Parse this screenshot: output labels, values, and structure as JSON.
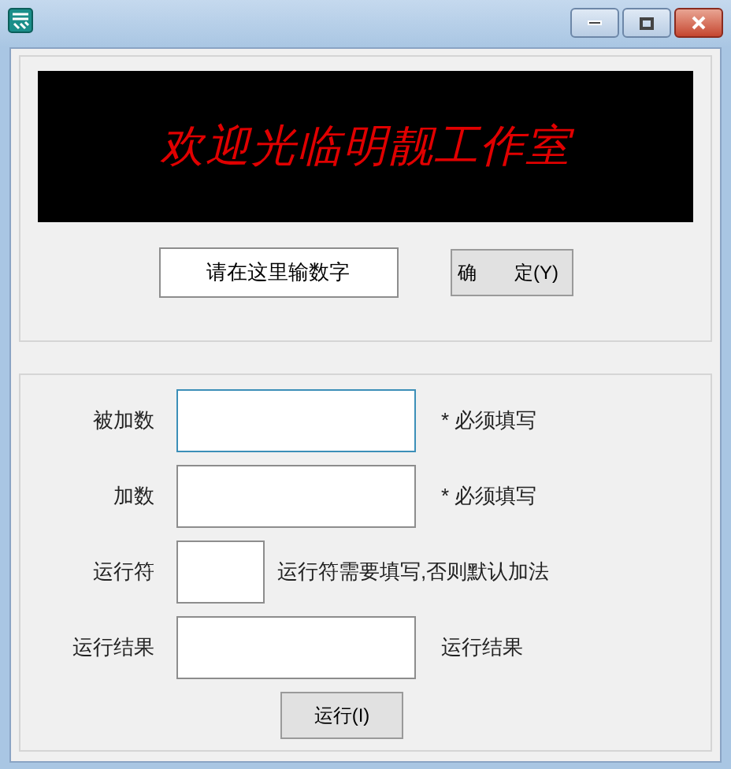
{
  "banner": {
    "text": "欢迎光临明靓工作室"
  },
  "top": {
    "input": {
      "value": "请在这里输数字"
    },
    "confirm_button": "确　　定(Y)"
  },
  "form": {
    "rows": [
      {
        "label": "被加数",
        "kind": "wide",
        "focused": true,
        "note": "* 必须填写"
      },
      {
        "label": "加数",
        "kind": "wide",
        "focused": false,
        "note": "* 必须填写"
      },
      {
        "label": "运行符",
        "kind": "narrow",
        "focused": false,
        "note": "运行符需要填写,否则默认加法"
      },
      {
        "label": "运行结果",
        "kind": "wide",
        "focused": false,
        "note": "运行结果"
      }
    ],
    "run_button": "运行(I)"
  }
}
